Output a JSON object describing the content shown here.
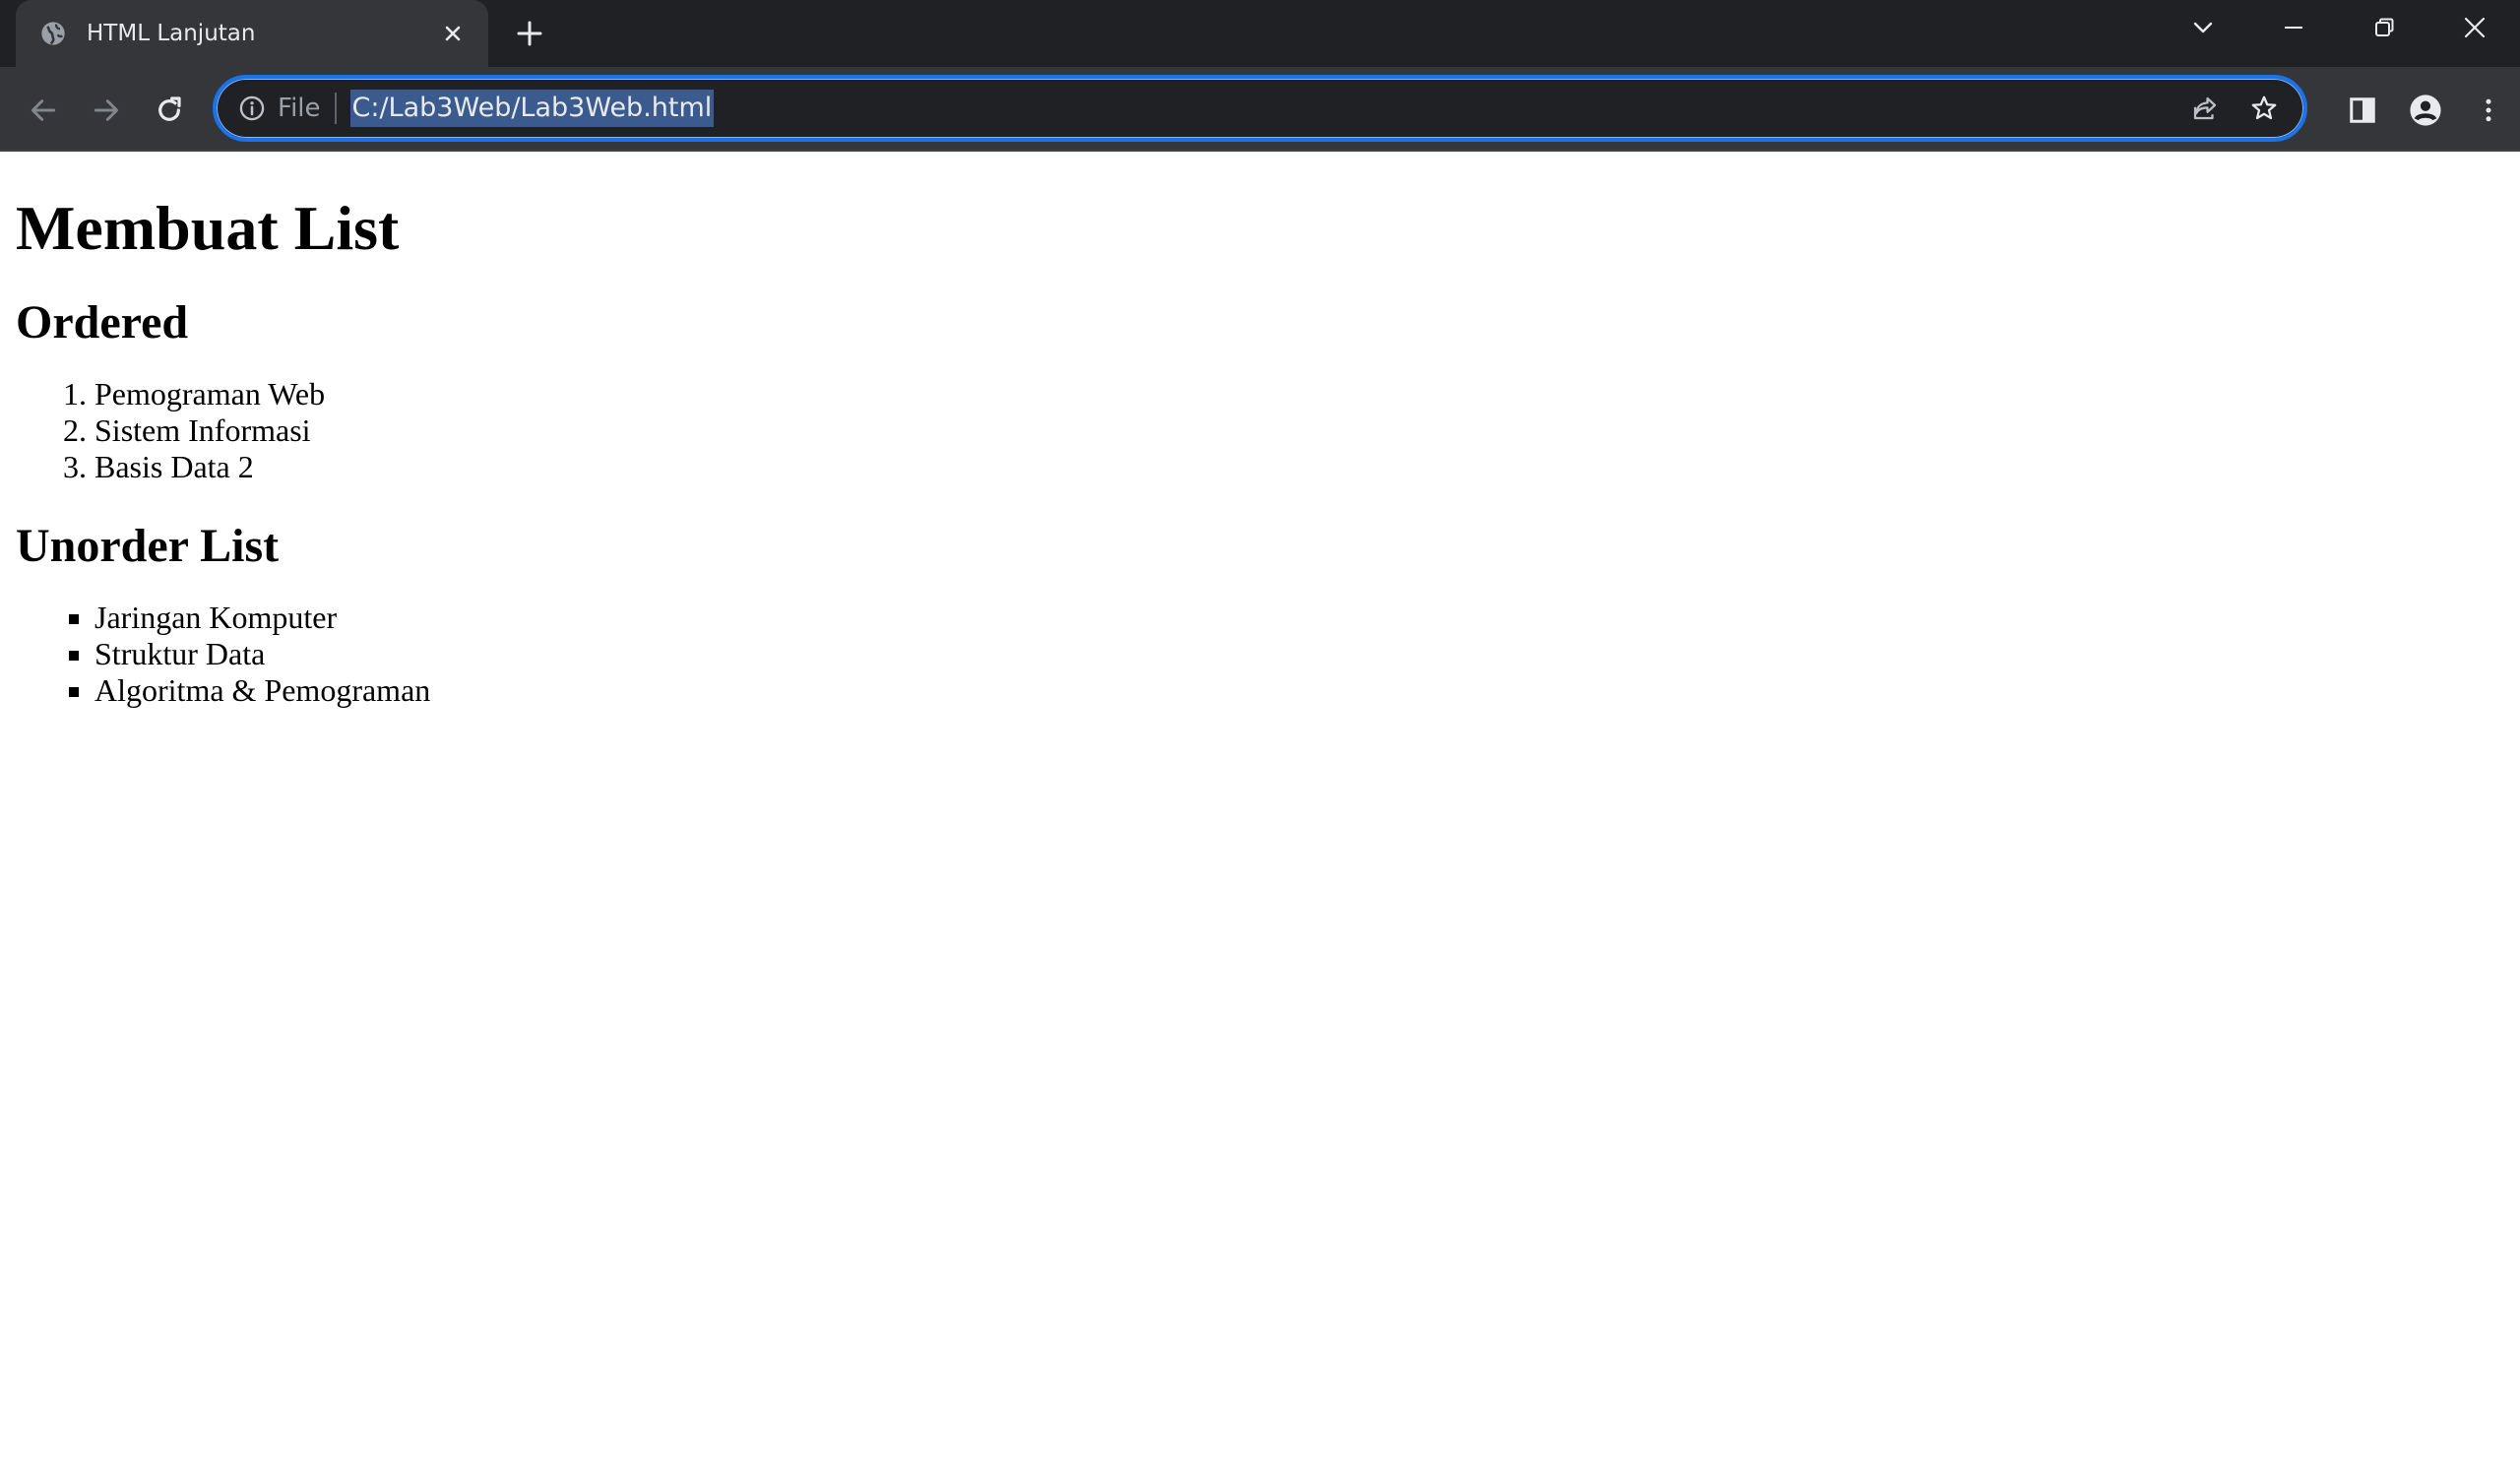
{
  "browser": {
    "tab_title": "HTML Lanjutan",
    "omnibox": {
      "chip": "File",
      "url": "C:/Lab3Web/Lab3Web.html"
    },
    "accent_color": "#1a73e8"
  },
  "page": {
    "heading": "Membuat List",
    "ordered": {
      "heading": "Ordered",
      "items": [
        "Pemograman Web",
        "Sistem Informasi",
        "Basis Data 2"
      ]
    },
    "unordered": {
      "heading": "Unorder List",
      "items": [
        "Jaringan Komputer",
        "Struktur Data",
        "Algoritma & Pemograman"
      ]
    }
  }
}
